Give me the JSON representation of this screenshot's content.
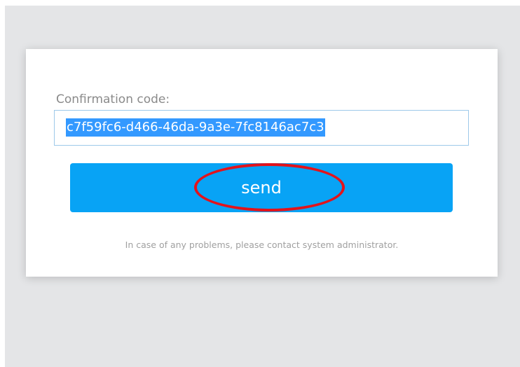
{
  "form": {
    "code_label": "Confirmation code:",
    "code_value": "c7f59fc6-d466-46da-9a3e-7fc8146ac7c3",
    "send_label": "send",
    "help_text": "In case of any problems, please contact system administrator."
  },
  "colors": {
    "page_background": "#e4e5e7",
    "card_background": "#ffffff",
    "button_background": "#08a3f5",
    "selection_highlight": "#3399ff",
    "annotation": "#e3131b"
  }
}
